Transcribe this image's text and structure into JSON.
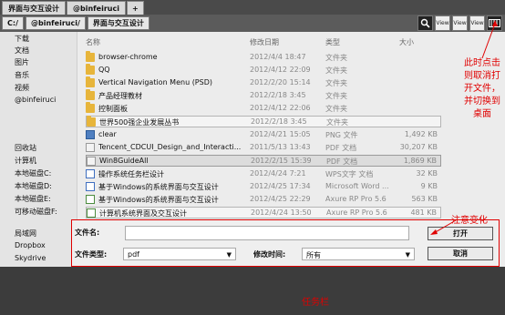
{
  "top_tabs": {
    "items": [
      "界面与交互设计",
      "@binfeiruci"
    ],
    "plus_label": "+"
  },
  "path": {
    "crumbs": [
      "C:/",
      "@binfeiruci/",
      "界面与交互设计"
    ]
  },
  "view_buttons": [
    {
      "icon": "search-icon",
      "label": ""
    },
    {
      "icon": "view-icon",
      "label": "View"
    },
    {
      "icon": "view-icon",
      "label": "View"
    },
    {
      "icon": "view-icon",
      "label": "View"
    },
    {
      "icon": "desktop-icon",
      "label": ""
    }
  ],
  "sidebar": {
    "group1": [
      "下载",
      "文档",
      "图片",
      "音乐",
      "视频",
      "@binfeiruci"
    ],
    "group2": [
      "回收站",
      "计算机",
      "本地磁盘C:",
      "本地磁盘D:",
      "本地磁盘E:",
      "可移动磁盘F:"
    ],
    "group3": [
      "局域网",
      "Dropbox",
      "Skydrive"
    ]
  },
  "columns": {
    "name": "名称",
    "modified": "修改日期",
    "type": "类型",
    "size": "大小"
  },
  "files": [
    {
      "name": "browser-chrome",
      "date": "2012/4/4 18:47",
      "type": "文件夹",
      "size": "",
      "icon": "folder-icon"
    },
    {
      "name": "QQ",
      "date": "2012/4/12 22:09",
      "type": "文件夹",
      "size": "",
      "icon": "folder-icon"
    },
    {
      "name": "Vertical Navigation Menu (PSD)",
      "date": "2012/2/20 15:14",
      "type": "文件夹",
      "size": "",
      "icon": "folder-icon"
    },
    {
      "name": "产品经理教材",
      "date": "2012/2/18 3:45",
      "type": "文件夹",
      "size": "",
      "icon": "folder-icon"
    },
    {
      "name": "控制面板",
      "date": "2012/4/12 22:06",
      "type": "文件夹",
      "size": "",
      "icon": "folder-icon"
    },
    {
      "name": "世界500强企业发展丛书",
      "date": "2012/2/18 3:45",
      "type": "文件夹",
      "size": "",
      "icon": "folder-icon"
    },
    {
      "name": "clear",
      "date": "2012/4/21 15:05",
      "type": "PNG 文件",
      "size": "1,492 KB",
      "icon": "png-file-icon"
    },
    {
      "name": "Tencent_CDCUI_Design_and_Interacti...",
      "date": "2011/5/13 13:43",
      "type": "PDF 文档",
      "size": "30,207 KB",
      "icon": "pdf-file-icon"
    },
    {
      "name": "Win8GuideAll",
      "date": "2012/2/15 15:39",
      "type": "PDF 文档",
      "size": "1,869 KB",
      "icon": "pdf-file-icon"
    },
    {
      "name": "操作系统任务栏设计",
      "date": "2012/4/24 7:21",
      "type": "WPS文字 文档",
      "size": "32 KB",
      "icon": "doc-file-icon"
    },
    {
      "name": "基于Windows的系统界面与交互设计",
      "date": "2012/4/25 17:34",
      "type": "Microsoft Word ...",
      "size": "9 KB",
      "icon": "doc-file-icon"
    },
    {
      "name": "基于Windows的系统界面与交互设计",
      "date": "2012/4/25 22:29",
      "type": "Axure RP Pro 5.6",
      "size": "563 KB",
      "icon": "rp-file-icon"
    },
    {
      "name": "计算机系统界面及交互设计",
      "date": "2012/4/24 13:50",
      "type": "Axure RP Pro 5.6",
      "size": "481 KB",
      "icon": "rp-file-icon"
    }
  ],
  "bottom": {
    "filename_label": "文件名:",
    "filename_value": "",
    "filetype_label": "文件类型:",
    "filetype_value": "pdf",
    "modtime_label": "修改时间:",
    "modtime_value": "所有",
    "open_label": "打开",
    "cancel_label": "取消"
  },
  "annotations": {
    "top_right": "此时点击则取消打开文件，并切换到桌面",
    "change": "注意变化",
    "taskbar": "任务栏"
  },
  "colors": {
    "annotation_red": "#e00000",
    "folder_yellow": "#e7b53b",
    "background_dark": "#3c3c3c"
  }
}
